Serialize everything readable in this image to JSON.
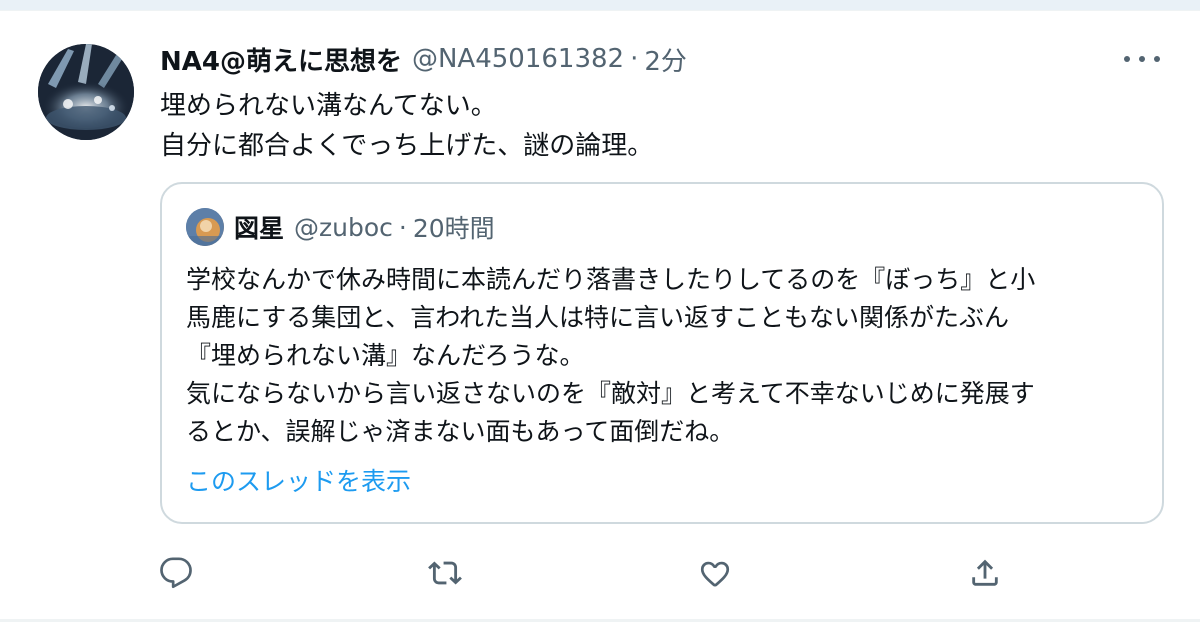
{
  "tweet": {
    "display_name": "NA4@萌えに思想を",
    "handle": "@NA450161382",
    "separator": "·",
    "time": "2分",
    "text_lines": [
      "埋められない溝なんてない。",
      "自分に都合よくでっち上げた、謎の論理。"
    ]
  },
  "quote": {
    "display_name": "図星",
    "handle": "@zuboc",
    "separator": "·",
    "time": "20時間",
    "text_lines": [
      "学校なんかで休み時間に本読んだり落書きしたりしてるのを『ぼっち』と小",
      "馬鹿にする集団と、言われた当人は特に言い返すこともない関係がたぶん",
      "『埋められない溝』なんだろうな。",
      "気にならないから言い返さないのを『敵対』と考えて不幸ないじめに発展す",
      "るとか、誤解じゃ済まない面もあって面倒だね。"
    ],
    "show_thread": "このスレッドを表示"
  },
  "actions": {
    "reply_icon": "reply-icon",
    "retweet_icon": "retweet-icon",
    "like_icon": "like-icon",
    "share_icon": "share-icon",
    "more_icon": "more-options-icon"
  },
  "colors": {
    "text_primary": "#0f1419",
    "text_secondary": "#536471",
    "link": "#1d9bf0",
    "border": "#cfd9de"
  }
}
